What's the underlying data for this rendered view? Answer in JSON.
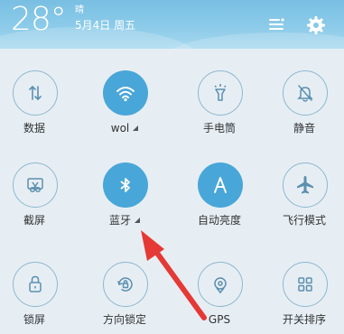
{
  "header": {
    "temperature": "28°",
    "weather": "晴",
    "date": "5月4日  周五",
    "icons": [
      "edit-icon",
      "gear-icon"
    ]
  },
  "tiles": [
    {
      "label": "数据",
      "state": "off",
      "icon": "data-arrows-icon"
    },
    {
      "label": "wol",
      "state": "on",
      "icon": "wifi-icon",
      "expand": true
    },
    {
      "label": "手电筒",
      "state": "off",
      "icon": "flashlight-icon"
    },
    {
      "label": "静音",
      "state": "off",
      "icon": "mute-bell-icon"
    },
    {
      "label": "截屏",
      "state": "off",
      "icon": "scissors-icon"
    },
    {
      "label": "蓝牙",
      "state": "on",
      "icon": "bluetooth-icon",
      "expand": true
    },
    {
      "label": "自动亮度",
      "state": "on",
      "icon": "auto-brightness-icon"
    },
    {
      "label": "飞行模式",
      "state": "off",
      "icon": "airplane-icon"
    },
    {
      "label": "锁屏",
      "state": "off",
      "icon": "lock-icon"
    },
    {
      "label": "方向锁定",
      "state": "off",
      "icon": "rotation-lock-icon"
    },
    {
      "label": "GPS",
      "state": "off",
      "icon": "gps-icon"
    },
    {
      "label": "开关排序",
      "state": "off",
      "icon": "sort-grid-icon"
    }
  ],
  "colors": {
    "accent": "#49a6d8",
    "header": "#86c7e7",
    "panel": "#e6eef4",
    "annotation_arrow": "#e53935"
  }
}
